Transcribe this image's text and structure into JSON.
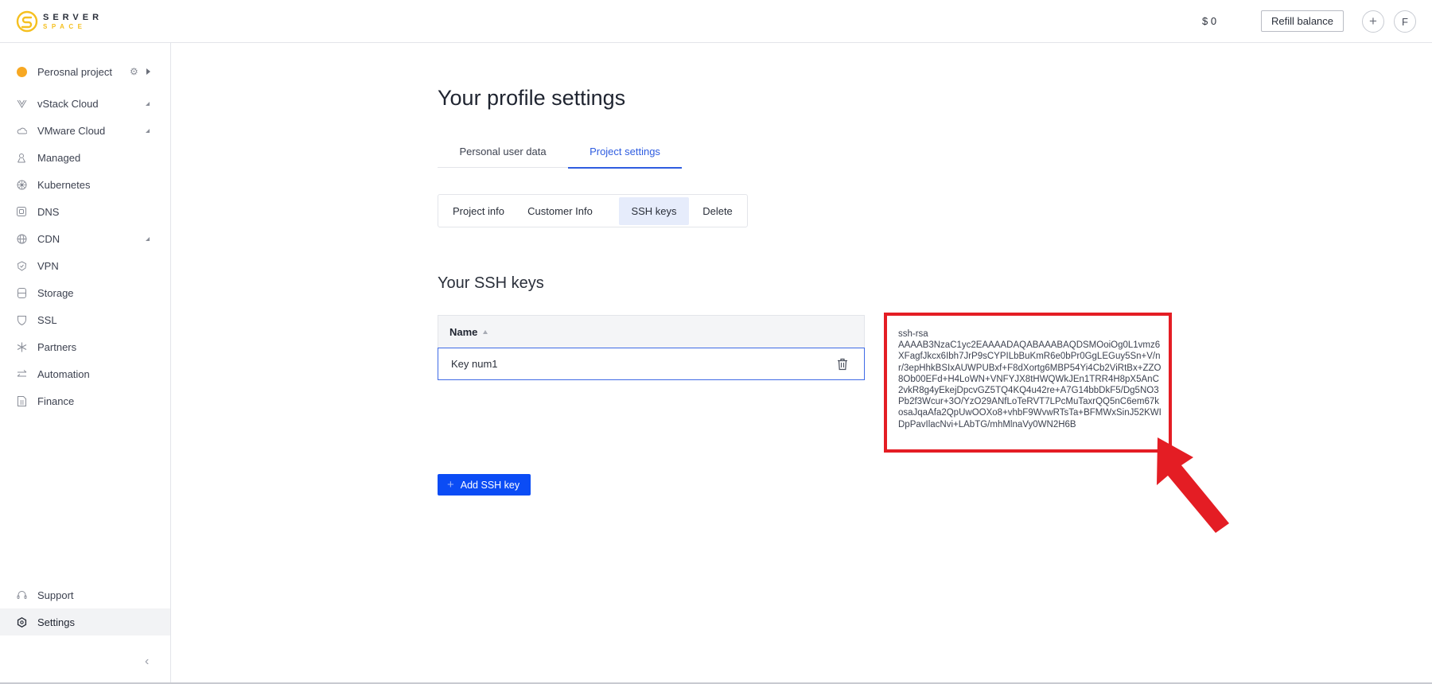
{
  "brand": {
    "top": "SERVER",
    "bottom": "SPACE",
    "accent": "#f5c020"
  },
  "header": {
    "balance": "$ 0",
    "refill_label": "Refill balance",
    "add_icon": "plus-icon",
    "avatar_initial": "F"
  },
  "sidebar": {
    "project": {
      "name": "Perosnal project",
      "icons": [
        "project-dot-icon",
        "gear-icon",
        "caret-right-icon"
      ]
    },
    "items": [
      {
        "label": "vStack Cloud",
        "icon": "vstack-icon",
        "expandable": true
      },
      {
        "label": "VMware Cloud",
        "icon": "cloud-icon",
        "expandable": true
      },
      {
        "label": "Managed",
        "icon": "managed-icon",
        "expandable": false
      },
      {
        "label": "Kubernetes",
        "icon": "kubernetes-icon",
        "expandable": false
      },
      {
        "label": "DNS",
        "icon": "dns-icon",
        "expandable": false
      },
      {
        "label": "CDN",
        "icon": "globe-icon",
        "expandable": true
      },
      {
        "label": "VPN",
        "icon": "shield-check-icon",
        "expandable": false
      },
      {
        "label": "Storage",
        "icon": "database-icon",
        "expandable": false
      },
      {
        "label": "SSL",
        "icon": "shield-icon",
        "expandable": false
      },
      {
        "label": "Partners",
        "icon": "snowflake-icon",
        "expandable": false
      },
      {
        "label": "Automation",
        "icon": "arrows-swap-icon",
        "expandable": false
      },
      {
        "label": "Finance",
        "icon": "document-icon",
        "expandable": false
      }
    ],
    "bottom_items": [
      {
        "label": "Support",
        "icon": "headset-icon",
        "active": false
      },
      {
        "label": "Settings",
        "icon": "gear-icon",
        "active": true
      }
    ],
    "collapse_icon": "chevron-left-icon"
  },
  "main": {
    "title": "Your profile settings",
    "tabs": [
      {
        "label": "Personal user data",
        "active": false
      },
      {
        "label": "Project settings",
        "active": true
      }
    ],
    "subtabs": [
      {
        "label": "Project info",
        "active": false
      },
      {
        "label": "Customer Info",
        "active": false
      },
      {
        "label": "SSH keys",
        "active": true
      },
      {
        "label": "Delete",
        "active": false
      }
    ],
    "section_title": "Your SSH keys",
    "table": {
      "columns": [
        {
          "label": "Name",
          "sort": "ascending"
        }
      ],
      "rows": [
        {
          "name": "Key num1",
          "action_icon": "trash-icon"
        }
      ]
    },
    "ssh_key_value": "ssh-rsa\nAAAAB3NzaC1yc2EAAAADAQABAAABAQDSMOoiOg0L1vmz6XFagfJkcx6Ibh7JrP9sCYPILbBuKmR6e0bPr0GgLEGuy5Sn+V/nr/3epHhkBSIxAUWPUBxf+F8dXortg6MBP54Yi4Cb2ViRtBx+ZZO8Ob00EFd+H4LoWN+VNFYJX8tHWQWkJEn1TRR4H8pX5AnC2vkR8g4yEkejDpcvGZ5TQ4KQ4u42re+A7G14bbDkF5/Dg5NO3Pb2f3Wcur+3O/YzO29ANfLoTeRVT7LPcMuTaxrQQ5nC6em67kosaJqaAfa2QpUwOOXo8+vhbF9WvwRTsTa+BFMWxSinJ52KWIDpPavIlacNvi+LAbTG/mhMlnaVy0WN2H6B",
    "add_button_label": "Add SSH key",
    "highlight_color": "#e41d24"
  }
}
